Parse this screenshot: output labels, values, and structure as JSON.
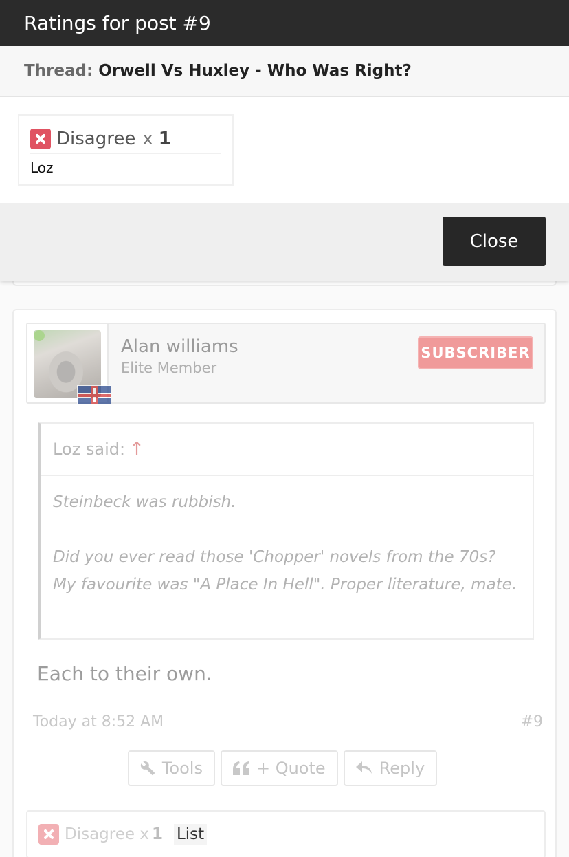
{
  "modal": {
    "title": "Ratings for post #9",
    "thread_prefix": "Thread:",
    "thread_title": "Orwell Vs Huxley - Who Was Right?",
    "rating": {
      "label": "Disagree",
      "x": "x",
      "count": "1",
      "users": [
        "Loz"
      ]
    },
    "close_label": "Close"
  },
  "post": {
    "author": {
      "name": "Alan williams",
      "role": "Elite Member",
      "badge": "SUBSCRIBER"
    },
    "quote": {
      "header": "Loz said:",
      "arrow": "↑",
      "lines": [
        "Steinbeck was rubbish.",
        "Did you ever read those 'Chopper' novels from the 70s? My favourite was \"A Place In Hell\". Proper literature, mate."
      ]
    },
    "message": "Each to their own.",
    "date": "Today at 8:52 AM",
    "number": "#9",
    "actions": {
      "tools": "Tools",
      "quote": "+ Quote",
      "reply": "Reply"
    },
    "ratings_bar": {
      "label": "Disagree x",
      "count": "1",
      "list": "List"
    }
  }
}
